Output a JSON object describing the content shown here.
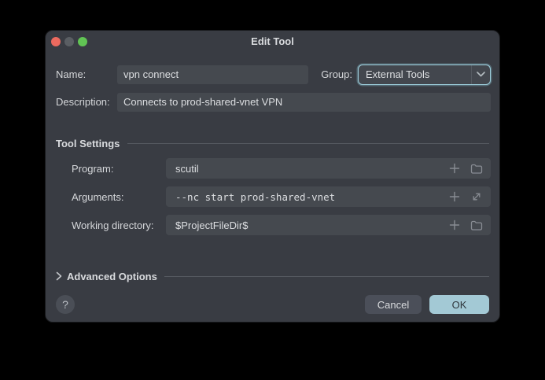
{
  "window": {
    "title": "Edit Tool"
  },
  "colors": {
    "dialog_background": "#393c43",
    "field_background": "#45494f",
    "focus_ring": "#9fd0de",
    "ok_button": "#a3c9d5",
    "traffic_close": "#ec6a5f",
    "traffic_minimize": "#5a5e63",
    "traffic_zoom": "#61c454"
  },
  "form": {
    "name_label": "Name:",
    "name_value": "vpn connect",
    "group_label": "Group:",
    "group_value": "External Tools",
    "description_label": "Description:",
    "description_value": "Connects to prod-shared-vnet VPN"
  },
  "tool_settings": {
    "header": "Tool Settings",
    "rows": [
      {
        "label": "Program:",
        "value": "scutil",
        "icons": [
          "plus-icon",
          "folder-icon"
        ]
      },
      {
        "label": "Arguments:",
        "value": "--nc start prod-shared-vnet",
        "icons": [
          "plus-icon",
          "expand-icon"
        ]
      },
      {
        "label": "Working directory:",
        "value": "$ProjectFileDir$",
        "icons": [
          "plus-icon",
          "folder-icon"
        ]
      }
    ]
  },
  "advanced": {
    "label": "Advanced Options"
  },
  "footer": {
    "help_label": "?",
    "cancel_label": "Cancel",
    "ok_label": "OK"
  }
}
